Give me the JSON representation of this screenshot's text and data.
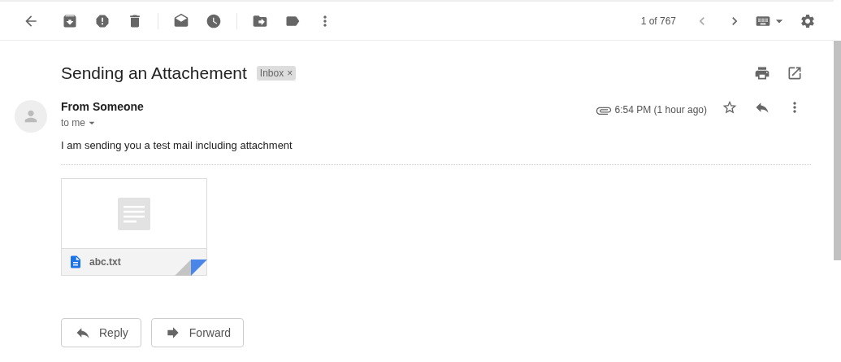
{
  "toolbar": {
    "pager": "1 of 767"
  },
  "message": {
    "subject": "Sending an Attachement",
    "label": {
      "text": "Inbox",
      "remove": "×"
    },
    "sender": "From Someone",
    "recipient": "to me",
    "time": "6:54 PM (1 hour ago)",
    "starred": false,
    "has_attachment": true,
    "body": "I am sending you a test mail including attachment",
    "attachments": [
      {
        "name": "abc.txt",
        "kind": "text"
      }
    ]
  },
  "actions": [
    "Reply",
    "Forward"
  ]
}
